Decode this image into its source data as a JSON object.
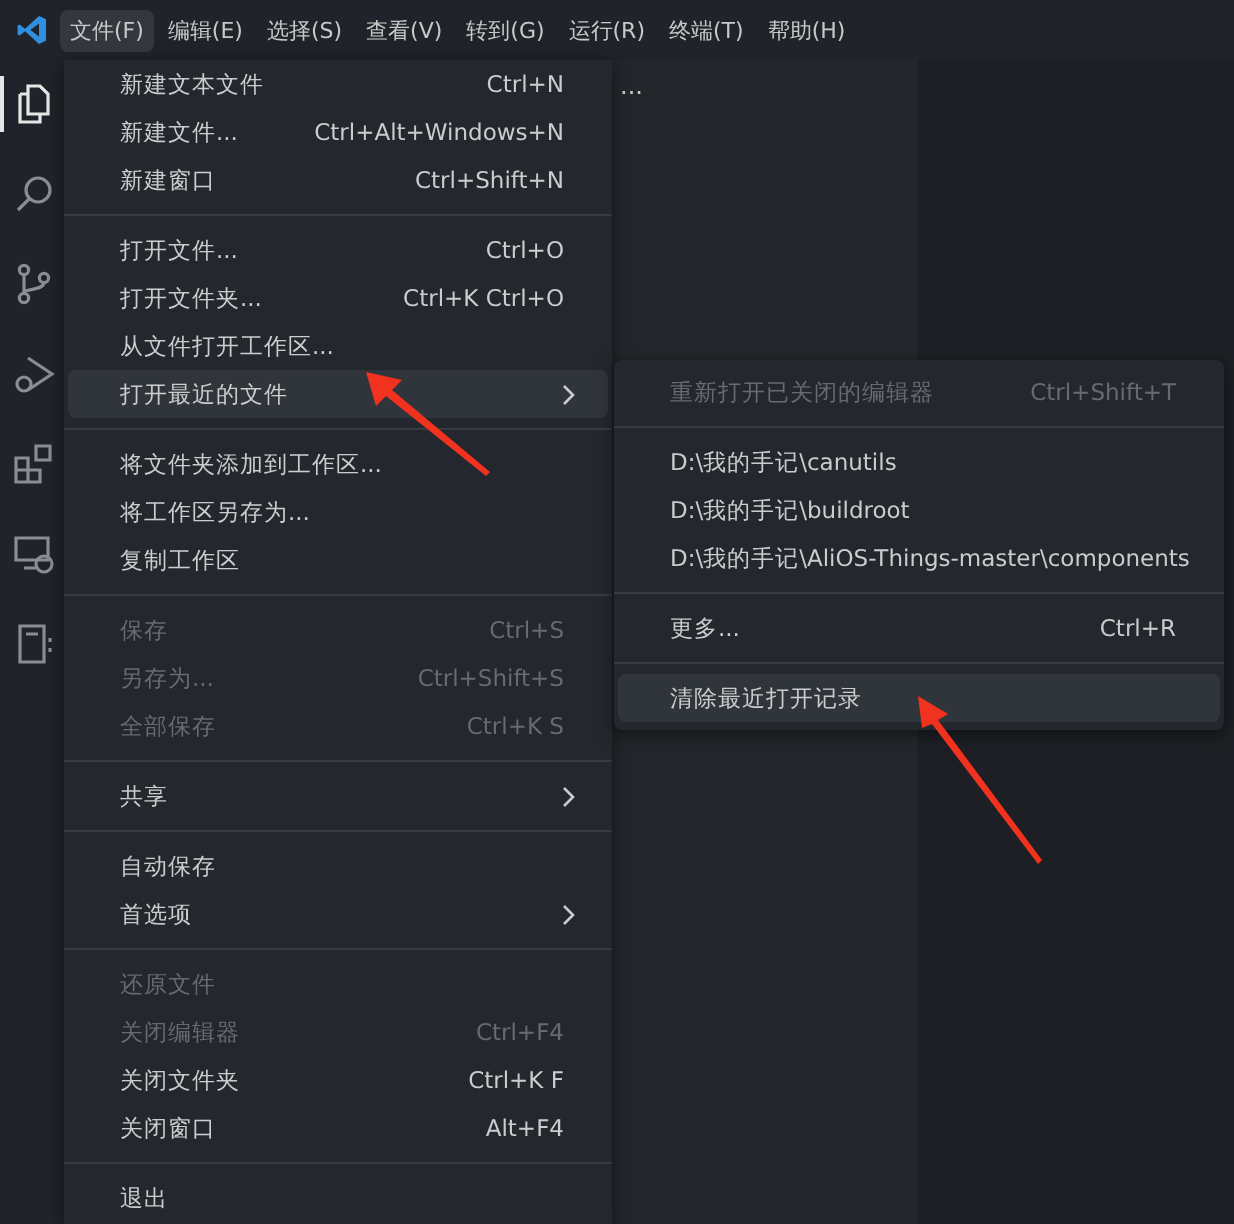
{
  "menubar": {
    "items": [
      {
        "label": "文件(F)",
        "selected": true
      },
      {
        "label": "编辑(E)",
        "selected": false
      },
      {
        "label": "选择(S)",
        "selected": false
      },
      {
        "label": "查看(V)",
        "selected": false
      },
      {
        "label": "转到(G)",
        "selected": false
      },
      {
        "label": "运行(R)",
        "selected": false
      },
      {
        "label": "终端(T)",
        "selected": false
      },
      {
        "label": "帮助(H)",
        "selected": false
      }
    ]
  },
  "activity_bar": {
    "items": [
      {
        "kind": "files",
        "selected": true
      },
      {
        "kind": "search",
        "selected": false
      },
      {
        "kind": "source-control",
        "selected": false
      },
      {
        "kind": "run-debug",
        "selected": false
      },
      {
        "kind": "extensions",
        "selected": false
      },
      {
        "kind": "remote",
        "selected": false
      },
      {
        "kind": "notebook",
        "selected": false
      }
    ]
  },
  "sidebar": {
    "more": "..."
  },
  "file_menu": {
    "groups": [
      [
        {
          "label": "新建文本文件",
          "shortcut": "Ctrl+N",
          "disabled": false,
          "submenu": false,
          "selected": false
        },
        {
          "label": "新建文件...",
          "shortcut": "Ctrl+Alt+Windows+N",
          "disabled": false,
          "submenu": false,
          "selected": false
        },
        {
          "label": "新建窗口",
          "shortcut": "Ctrl+Shift+N",
          "disabled": false,
          "submenu": false,
          "selected": false
        }
      ],
      [
        {
          "label": "打开文件...",
          "shortcut": "Ctrl+O",
          "disabled": false,
          "submenu": false,
          "selected": false
        },
        {
          "label": "打开文件夹...",
          "shortcut": "Ctrl+K Ctrl+O",
          "disabled": false,
          "submenu": false,
          "selected": false
        },
        {
          "label": "从文件打开工作区...",
          "disabled": false,
          "submenu": false,
          "selected": false
        },
        {
          "label": "打开最近的文件",
          "disabled": false,
          "submenu": true,
          "selected": true
        }
      ],
      [
        {
          "label": "将文件夹添加到工作区...",
          "disabled": false,
          "submenu": false,
          "selected": false
        },
        {
          "label": "将工作区另存为...",
          "disabled": false,
          "submenu": false,
          "selected": false
        },
        {
          "label": "复制工作区",
          "disabled": false,
          "submenu": false,
          "selected": false
        }
      ],
      [
        {
          "label": "保存",
          "shortcut": "Ctrl+S",
          "disabled": true,
          "submenu": false,
          "selected": false
        },
        {
          "label": "另存为...",
          "shortcut": "Ctrl+Shift+S",
          "disabled": true,
          "submenu": false,
          "selected": false
        },
        {
          "label": "全部保存",
          "shortcut": "Ctrl+K S",
          "disabled": true,
          "submenu": false,
          "selected": false
        }
      ],
      [
        {
          "label": "共享",
          "disabled": false,
          "submenu": true,
          "selected": false
        }
      ],
      [
        {
          "label": "自动保存",
          "disabled": false,
          "submenu": false,
          "selected": false
        },
        {
          "label": "首选项",
          "disabled": false,
          "submenu": true,
          "selected": false
        }
      ],
      [
        {
          "label": "还原文件",
          "disabled": true,
          "submenu": false,
          "selected": false
        },
        {
          "label": "关闭编辑器",
          "shortcut": "Ctrl+F4",
          "disabled": true,
          "submenu": false,
          "selected": false
        },
        {
          "label": "关闭文件夹",
          "shortcut": "Ctrl+K F",
          "disabled": false,
          "submenu": false,
          "selected": false
        },
        {
          "label": "关闭窗口",
          "shortcut": "Alt+F4",
          "disabled": false,
          "submenu": false,
          "selected": false
        }
      ],
      [
        {
          "label": "退出",
          "disabled": false,
          "submenu": false,
          "selected": false
        }
      ]
    ]
  },
  "recent_submenu": {
    "groups": [
      [
        {
          "label": "重新打开已关闭的编辑器",
          "shortcut": "Ctrl+Shift+T",
          "disabled": true,
          "selected": false
        }
      ],
      [
        {
          "label": "D:\\我的手记\\canutils",
          "disabled": false,
          "selected": false
        },
        {
          "label": "D:\\我的手记\\buildroot",
          "disabled": false,
          "selected": false
        },
        {
          "label": "D:\\我的手记\\AliOS-Things-master\\components",
          "disabled": false,
          "selected": false
        }
      ],
      [
        {
          "label": "更多...",
          "shortcut": "Ctrl+R",
          "disabled": false,
          "selected": false
        }
      ],
      [
        {
          "label": "清除最近打开记录",
          "disabled": false,
          "selected": true
        }
      ]
    ]
  }
}
